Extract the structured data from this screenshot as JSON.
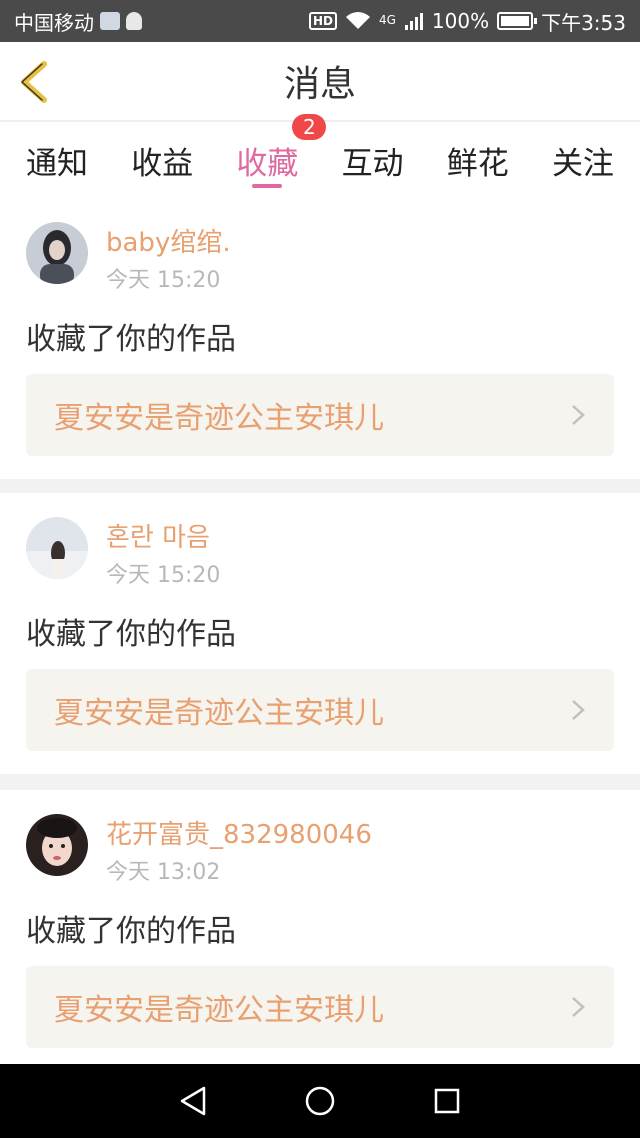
{
  "status_bar": {
    "carrier": "中国移动",
    "hd_label": "HD",
    "network": "4G",
    "battery": "100%",
    "time": "下午3:53"
  },
  "header": {
    "title": "消息",
    "back_icon": "chevron-left-icon",
    "accent_color": "#e8c040"
  },
  "tabs": [
    {
      "label": "通知",
      "active": false
    },
    {
      "label": "收益",
      "active": false
    },
    {
      "label": "收藏",
      "active": true,
      "badge": "2"
    },
    {
      "label": "互动",
      "active": false
    },
    {
      "label": "鲜花",
      "active": false
    },
    {
      "label": "关注",
      "active": false
    }
  ],
  "colors": {
    "active_tab": "#e06aa0",
    "username": "#e8a070",
    "badge": "#f04848"
  },
  "messages": [
    {
      "username": "baby绾绾.",
      "time": "今天 15:20",
      "action": "收藏了你的作品",
      "work_title": "夏安安是奇迹公主安琪儿"
    },
    {
      "username": "혼란 마음",
      "time": "今天 15:20",
      "action": "收藏了你的作品",
      "work_title": "夏安安是奇迹公主安琪儿"
    },
    {
      "username": "花开富贵_832980046",
      "time": "今天 13:02",
      "action": "收藏了你的作品",
      "work_title": "夏安安是奇迹公主安琪儿"
    }
  ],
  "nav": {
    "back_icon": "triangle-back-icon",
    "home_icon": "circle-home-icon",
    "recents_icon": "square-recents-icon"
  }
}
